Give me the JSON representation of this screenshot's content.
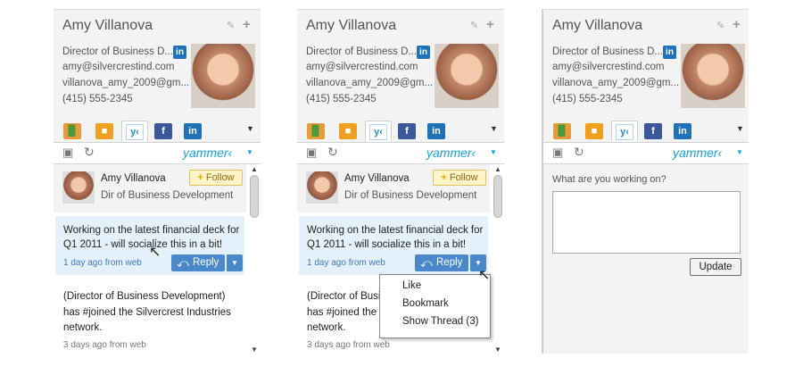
{
  "profile": {
    "name": "Amy Villanova",
    "title": "Director of Business D...",
    "email": "amy@silvercrestind.com",
    "alt_email": "villanova_amy_2009@gm...",
    "phone": "(415) 555-2345",
    "linkedin_badge": "in"
  },
  "tabs": {
    "yammer_glyph": "y‹",
    "facebook_glyph": "f",
    "linkedin_glyph": "in"
  },
  "toolbar": {
    "brand": "yammer‹"
  },
  "feed": {
    "user_name": "Amy Villanova",
    "user_title": "Dir of Business Development",
    "follow_label": "Follow",
    "post_text": "Working on the latest financial deck for Q1 2011 - will socialize this in a bit!",
    "post_time": "1 day ago from web",
    "reply_label": "Reply",
    "post2_text": "(Director of Business Development) has #joined the Silvercrest Industries network.",
    "post2_time": "3 days ago from web"
  },
  "menu": {
    "items": [
      "Like",
      "Bookmark",
      "Show Thread (3)"
    ]
  },
  "compose": {
    "label": "What are you working on?",
    "update_label": "Update",
    "value": ""
  },
  "colors": {
    "accent": "#1aa1d6",
    "reply_button": "#4b88c9",
    "post_highlight": "#e4f1fb"
  }
}
